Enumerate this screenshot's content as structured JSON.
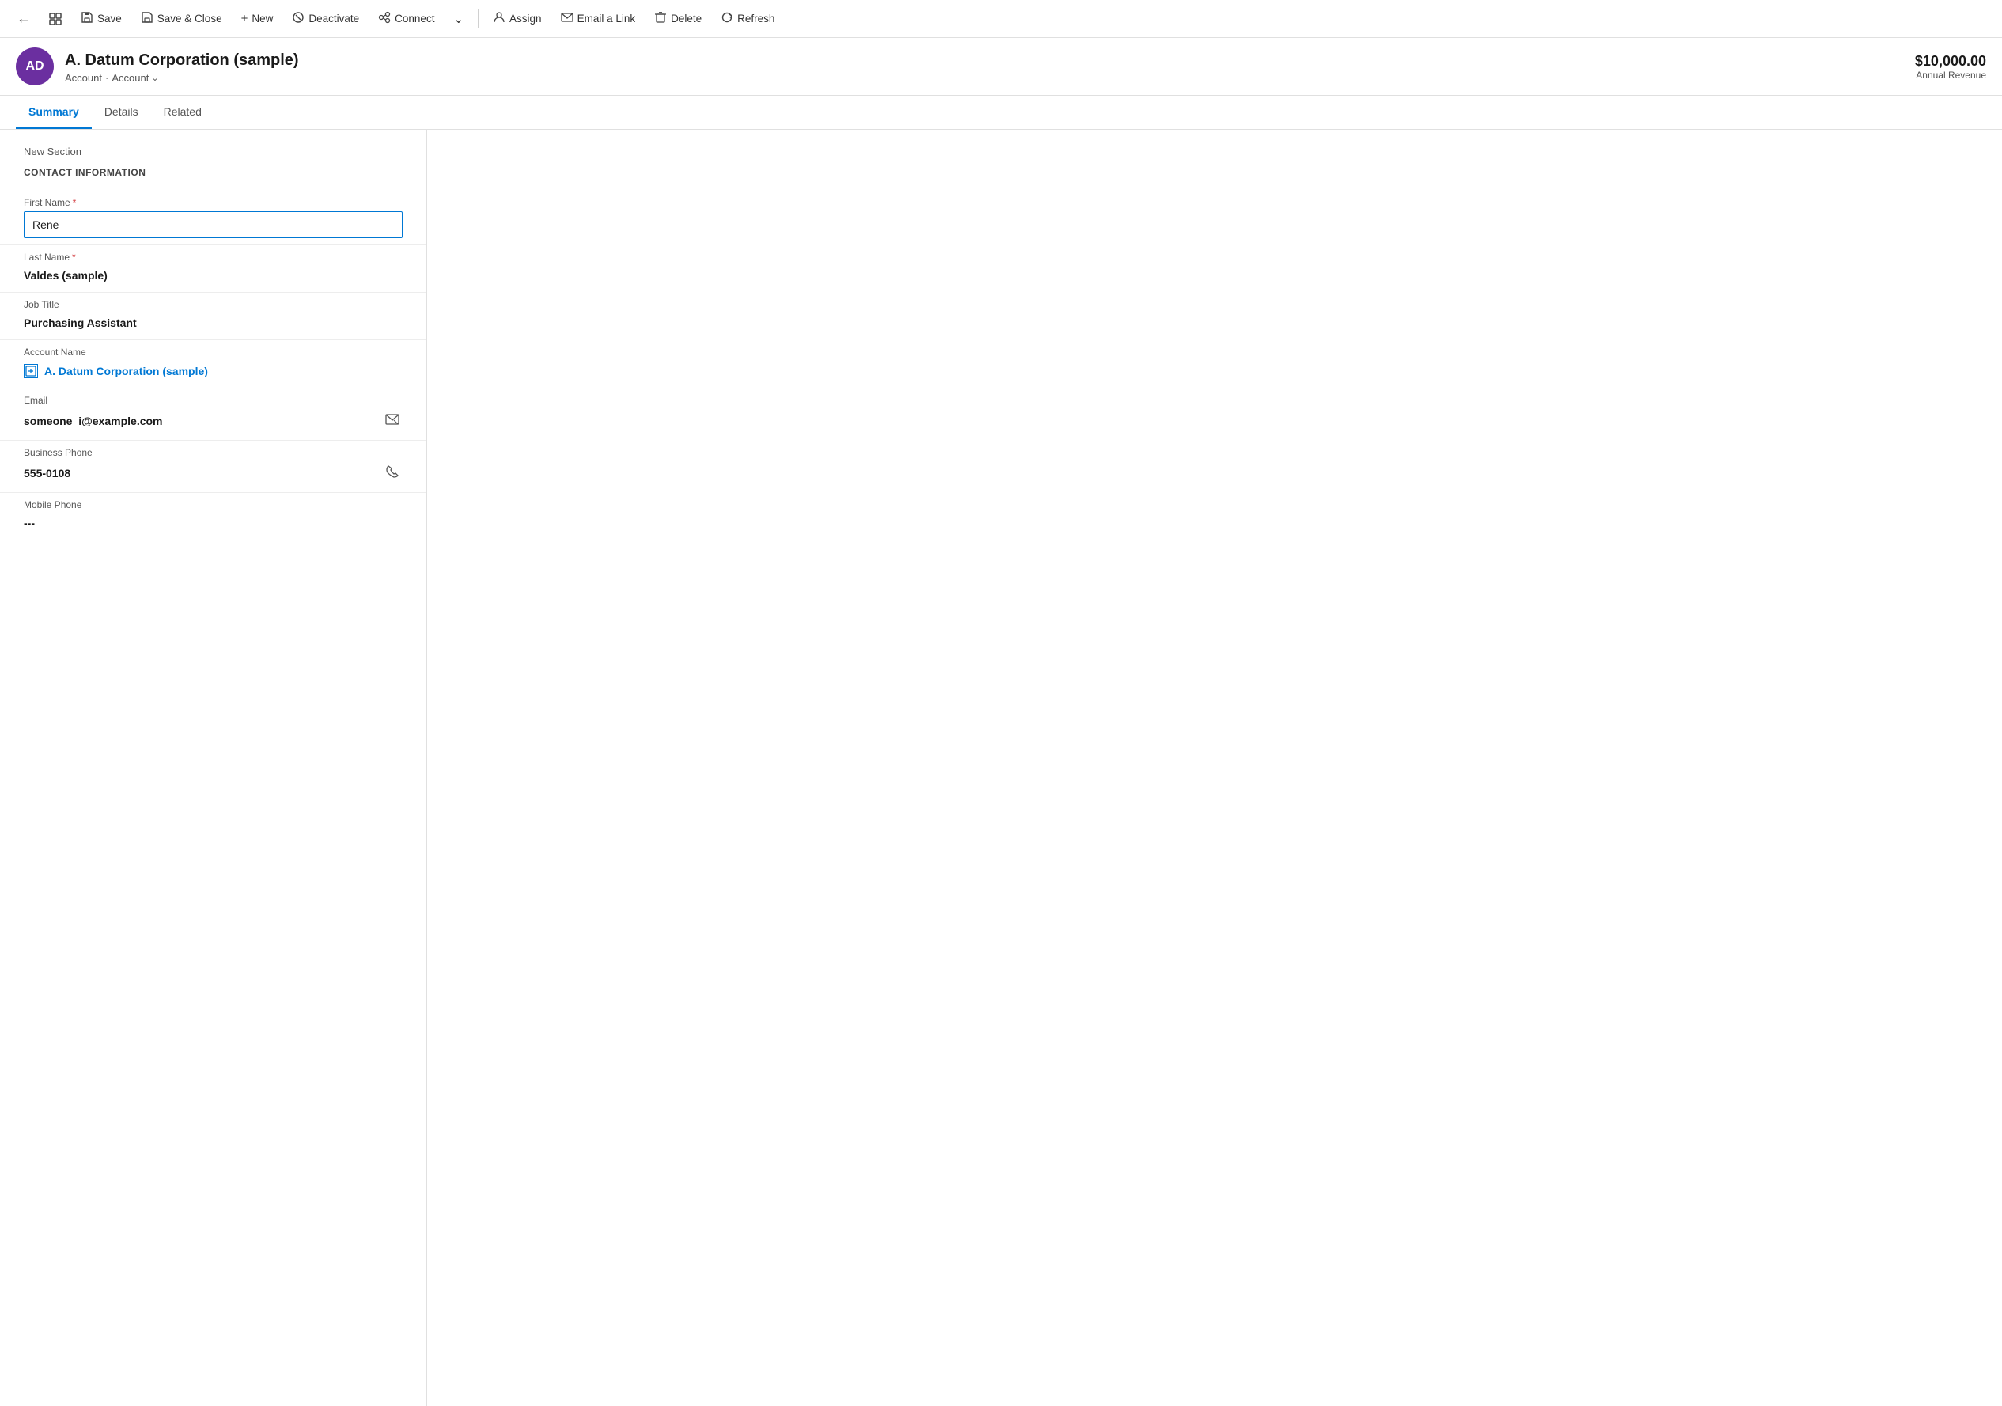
{
  "toolbar": {
    "back_title": "Back",
    "grid_title": "Grid view",
    "save_label": "Save",
    "save_close_label": "Save & Close",
    "new_label": "New",
    "deactivate_label": "Deactivate",
    "connect_label": "Connect",
    "more_label": "More",
    "assign_label": "Assign",
    "email_link_label": "Email a Link",
    "delete_label": "Delete",
    "refresh_label": "Refresh"
  },
  "record": {
    "avatar_initials": "AD",
    "title": "A. Datum Corporation (sample)",
    "breadcrumb_type": "Account",
    "breadcrumb_entity": "Account",
    "annual_revenue": "$10,000.00",
    "annual_revenue_label": "Annual Revenue"
  },
  "tabs": [
    {
      "label": "Summary",
      "active": true
    },
    {
      "label": "Details",
      "active": false
    },
    {
      "label": "Related",
      "active": false
    }
  ],
  "form": {
    "section_label": "New Section",
    "section_heading": "CONTACT INFORMATION",
    "fields": [
      {
        "id": "first_name",
        "label": "First Name",
        "required": true,
        "type": "input",
        "value": "Rene"
      },
      {
        "id": "last_name",
        "label": "Last Name",
        "required": true,
        "type": "text",
        "value": "Valdes (sample)"
      },
      {
        "id": "job_title",
        "label": "Job Title",
        "required": false,
        "type": "text",
        "value": "Purchasing Assistant"
      },
      {
        "id": "account_name",
        "label": "Account Name",
        "required": false,
        "type": "link",
        "value": "A. Datum Corporation (sample)"
      },
      {
        "id": "email",
        "label": "Email",
        "required": false,
        "type": "text_with_action",
        "value": "someone_i@example.com",
        "action_icon": "email"
      },
      {
        "id": "business_phone",
        "label": "Business Phone",
        "required": false,
        "type": "text_with_action",
        "value": "555-0108",
        "action_icon": "phone"
      },
      {
        "id": "mobile_phone",
        "label": "Mobile Phone",
        "required": false,
        "type": "text",
        "value": "---"
      }
    ]
  }
}
